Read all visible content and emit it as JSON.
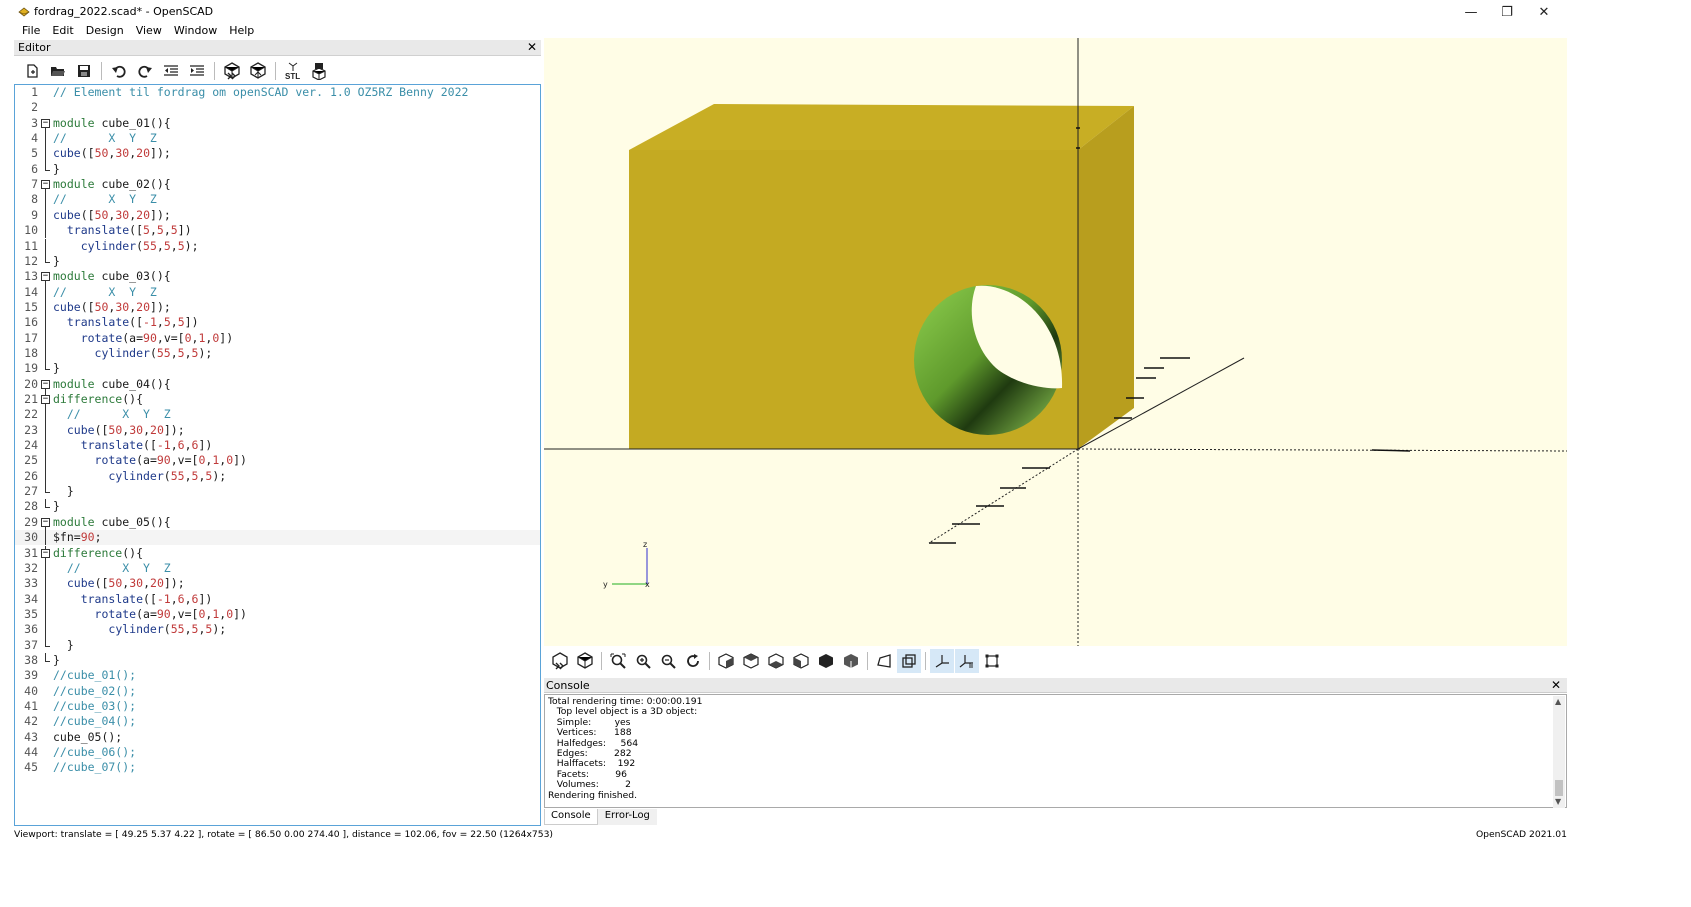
{
  "window": {
    "title": "fordrag_2022.scad* - OpenSCAD",
    "minimize_symbol": "—",
    "maximize_symbol": "❐",
    "close_symbol": "✕"
  },
  "menu": [
    "File",
    "Edit",
    "Design",
    "View",
    "Window",
    "Help"
  ],
  "editor": {
    "title": "Editor",
    "close_symbol": "✕",
    "toolbar": [
      "new-file-icon",
      "open-file-icon",
      "save-icon",
      "undo-icon",
      "redo-icon",
      "unindent-icon",
      "indent-icon",
      "preview-icon",
      "render-icon",
      "export-stl-icon",
      "send-to-print-icon"
    ],
    "stl_label": "STL",
    "current_line": 30,
    "lines": [
      {
        "n": "1",
        "parts": [
          [
            "c",
            "// Element til fordrag om openSCAD ver. 1.0 OZ5RZ Benny 2022"
          ]
        ]
      },
      {
        "n": "2",
        "parts": []
      },
      {
        "n": "3",
        "fold": "open",
        "parts": [
          [
            "k",
            "module"
          ],
          [
            "p",
            " cube_01(){"
          ]
        ]
      },
      {
        "n": "4",
        "parts": [
          [
            "c",
            "//      X  Y  Z"
          ]
        ]
      },
      {
        "n": "5",
        "parts": [
          [
            "f",
            "cube"
          ],
          [
            "p",
            "(["
          ],
          [
            "d",
            "50"
          ],
          [
            "p",
            ","
          ],
          [
            "d",
            "30"
          ],
          [
            "p",
            ","
          ],
          [
            "d",
            "20"
          ],
          [
            "p",
            "]);"
          ]
        ]
      },
      {
        "n": "6",
        "fold": "end",
        "parts": [
          [
            "p",
            "}"
          ]
        ]
      },
      {
        "n": "7",
        "fold": "open",
        "parts": [
          [
            "k",
            "module"
          ],
          [
            "p",
            " cube_02(){"
          ]
        ]
      },
      {
        "n": "8",
        "parts": [
          [
            "c",
            "//      X  Y  Z"
          ]
        ]
      },
      {
        "n": "9",
        "parts": [
          [
            "f",
            "cube"
          ],
          [
            "p",
            "(["
          ],
          [
            "d",
            "50"
          ],
          [
            "p",
            ","
          ],
          [
            "d",
            "30"
          ],
          [
            "p",
            ","
          ],
          [
            "d",
            "20"
          ],
          [
            "p",
            "]);"
          ]
        ]
      },
      {
        "n": "10",
        "parts": [
          [
            "p",
            "  "
          ],
          [
            "f",
            "translate"
          ],
          [
            "p",
            "(["
          ],
          [
            "d",
            "5"
          ],
          [
            "p",
            ","
          ],
          [
            "d",
            "5"
          ],
          [
            "p",
            ","
          ],
          [
            "d",
            "5"
          ],
          [
            "p",
            "])"
          ]
        ]
      },
      {
        "n": "11",
        "parts": [
          [
            "p",
            "    "
          ],
          [
            "f",
            "cylinder"
          ],
          [
            "p",
            "("
          ],
          [
            "d",
            "55"
          ],
          [
            "p",
            ","
          ],
          [
            "d",
            "5"
          ],
          [
            "p",
            ","
          ],
          [
            "d",
            "5"
          ],
          [
            "p",
            ");"
          ]
        ]
      },
      {
        "n": "12",
        "fold": "end",
        "parts": [
          [
            "p",
            "}"
          ]
        ]
      },
      {
        "n": "13",
        "fold": "open",
        "parts": [
          [
            "k",
            "module"
          ],
          [
            "p",
            " cube_03(){"
          ]
        ]
      },
      {
        "n": "14",
        "parts": [
          [
            "c",
            "//      X  Y  Z"
          ]
        ]
      },
      {
        "n": "15",
        "parts": [
          [
            "f",
            "cube"
          ],
          [
            "p",
            "(["
          ],
          [
            "d",
            "50"
          ],
          [
            "p",
            ","
          ],
          [
            "d",
            "30"
          ],
          [
            "p",
            ","
          ],
          [
            "d",
            "20"
          ],
          [
            "p",
            "]);"
          ]
        ]
      },
      {
        "n": "16",
        "parts": [
          [
            "p",
            "  "
          ],
          [
            "f",
            "translate"
          ],
          [
            "p",
            "(["
          ],
          [
            "d",
            "-1"
          ],
          [
            "p",
            ","
          ],
          [
            "d",
            "5"
          ],
          [
            "p",
            ","
          ],
          [
            "d",
            "5"
          ],
          [
            "p",
            "])"
          ]
        ]
      },
      {
        "n": "17",
        "parts": [
          [
            "p",
            "    "
          ],
          [
            "f",
            "rotate"
          ],
          [
            "p",
            "(a="
          ],
          [
            "d",
            "90"
          ],
          [
            "p",
            ",v=["
          ],
          [
            "d",
            "0"
          ],
          [
            "p",
            ","
          ],
          [
            "d",
            "1"
          ],
          [
            "p",
            ","
          ],
          [
            "d",
            "0"
          ],
          [
            "p",
            "])"
          ]
        ]
      },
      {
        "n": "18",
        "parts": [
          [
            "p",
            "      "
          ],
          [
            "f",
            "cylinder"
          ],
          [
            "p",
            "("
          ],
          [
            "d",
            "55"
          ],
          [
            "p",
            ","
          ],
          [
            "d",
            "5"
          ],
          [
            "p",
            ","
          ],
          [
            "d",
            "5"
          ],
          [
            "p",
            ");"
          ]
        ]
      },
      {
        "n": "19",
        "fold": "end",
        "parts": [
          [
            "p",
            "}"
          ]
        ]
      },
      {
        "n": "20",
        "fold": "open",
        "parts": [
          [
            "k",
            "module"
          ],
          [
            "p",
            " cube_04(){"
          ]
        ]
      },
      {
        "n": "21",
        "fold": "open",
        "parts": [
          [
            "k",
            "difference"
          ],
          [
            "p",
            "(){"
          ]
        ]
      },
      {
        "n": "22",
        "parts": [
          [
            "p",
            "  "
          ],
          [
            "c",
            "//      X  Y  Z"
          ]
        ]
      },
      {
        "n": "23",
        "parts": [
          [
            "p",
            "  "
          ],
          [
            "f",
            "cube"
          ],
          [
            "p",
            "(["
          ],
          [
            "d",
            "50"
          ],
          [
            "p",
            ","
          ],
          [
            "d",
            "30"
          ],
          [
            "p",
            ","
          ],
          [
            "d",
            "20"
          ],
          [
            "p",
            "]);"
          ]
        ]
      },
      {
        "n": "24",
        "parts": [
          [
            "p",
            "    "
          ],
          [
            "f",
            "translate"
          ],
          [
            "p",
            "(["
          ],
          [
            "d",
            "-1"
          ],
          [
            "p",
            ","
          ],
          [
            "d",
            "6"
          ],
          [
            "p",
            ","
          ],
          [
            "d",
            "6"
          ],
          [
            "p",
            "])"
          ]
        ]
      },
      {
        "n": "25",
        "parts": [
          [
            "p",
            "      "
          ],
          [
            "f",
            "rotate"
          ],
          [
            "p",
            "(a="
          ],
          [
            "d",
            "90"
          ],
          [
            "p",
            ",v=["
          ],
          [
            "d",
            "0"
          ],
          [
            "p",
            ","
          ],
          [
            "d",
            "1"
          ],
          [
            "p",
            ","
          ],
          [
            "d",
            "0"
          ],
          [
            "p",
            "])"
          ]
        ]
      },
      {
        "n": "26",
        "parts": [
          [
            "p",
            "        "
          ],
          [
            "f",
            "cylinder"
          ],
          [
            "p",
            "("
          ],
          [
            "d",
            "55"
          ],
          [
            "p",
            ","
          ],
          [
            "d",
            "5"
          ],
          [
            "p",
            ","
          ],
          [
            "d",
            "5"
          ],
          [
            "p",
            ");"
          ]
        ]
      },
      {
        "n": "27",
        "fold": "mid",
        "parts": [
          [
            "p",
            "  }"
          ]
        ]
      },
      {
        "n": "28",
        "fold": "end",
        "parts": [
          [
            "p",
            "}"
          ]
        ]
      },
      {
        "n": "29",
        "fold": "open",
        "parts": [
          [
            "k",
            "module"
          ],
          [
            "p",
            " cube_05(){"
          ]
        ]
      },
      {
        "n": "30",
        "parts": [
          [
            "p",
            "$fn="
          ],
          [
            "d",
            "90"
          ],
          [
            "p",
            ";"
          ]
        ]
      },
      {
        "n": "31",
        "fold": "open",
        "parts": [
          [
            "k",
            "difference"
          ],
          [
            "p",
            "(){"
          ]
        ]
      },
      {
        "n": "32",
        "parts": [
          [
            "p",
            "  "
          ],
          [
            "c",
            "//      X  Y  Z"
          ]
        ]
      },
      {
        "n": "33",
        "parts": [
          [
            "p",
            "  "
          ],
          [
            "f",
            "cube"
          ],
          [
            "p",
            "(["
          ],
          [
            "d",
            "50"
          ],
          [
            "p",
            ","
          ],
          [
            "d",
            "30"
          ],
          [
            "p",
            ","
          ],
          [
            "d",
            "20"
          ],
          [
            "p",
            "]);"
          ]
        ]
      },
      {
        "n": "34",
        "parts": [
          [
            "p",
            "    "
          ],
          [
            "f",
            "translate"
          ],
          [
            "p",
            "(["
          ],
          [
            "d",
            "-1"
          ],
          [
            "p",
            ","
          ],
          [
            "d",
            "6"
          ],
          [
            "p",
            ","
          ],
          [
            "d",
            "6"
          ],
          [
            "p",
            "])"
          ]
        ]
      },
      {
        "n": "35",
        "parts": [
          [
            "p",
            "      "
          ],
          [
            "f",
            "rotate"
          ],
          [
            "p",
            "(a="
          ],
          [
            "d",
            "90"
          ],
          [
            "p",
            ",v=["
          ],
          [
            "d",
            "0"
          ],
          [
            "p",
            ","
          ],
          [
            "d",
            "1"
          ],
          [
            "p",
            ","
          ],
          [
            "d",
            "0"
          ],
          [
            "p",
            "])"
          ]
        ]
      },
      {
        "n": "36",
        "parts": [
          [
            "p",
            "        "
          ],
          [
            "f",
            "cylinder"
          ],
          [
            "p",
            "("
          ],
          [
            "d",
            "55"
          ],
          [
            "p",
            ","
          ],
          [
            "d",
            "5"
          ],
          [
            "p",
            ","
          ],
          [
            "d",
            "5"
          ],
          [
            "p",
            ");"
          ]
        ]
      },
      {
        "n": "37",
        "fold": "mid",
        "parts": [
          [
            "p",
            "  }"
          ]
        ]
      },
      {
        "n": "38",
        "fold": "end",
        "parts": [
          [
            "p",
            "}"
          ]
        ]
      },
      {
        "n": "39",
        "parts": [
          [
            "c",
            "//cube_01();"
          ]
        ]
      },
      {
        "n": "40",
        "parts": [
          [
            "c",
            "//cube_02();"
          ]
        ]
      },
      {
        "n": "41",
        "parts": [
          [
            "c",
            "//cube_03();"
          ]
        ]
      },
      {
        "n": "42",
        "parts": [
          [
            "c",
            "//cube_04();"
          ]
        ]
      },
      {
        "n": "43",
        "parts": [
          [
            "p",
            "cube_05();"
          ]
        ]
      },
      {
        "n": "44",
        "parts": [
          [
            "c",
            "//cube_06();"
          ]
        ]
      },
      {
        "n": "45",
        "parts": [
          [
            "c",
            "//cube_07();"
          ]
        ]
      }
    ]
  },
  "viewport": {
    "axis_labels": {
      "z": "z",
      "y": "y",
      "x": "x"
    },
    "colors": {
      "background": "#fffde6",
      "model": "#c4aa22",
      "model_top": "#c8ae24",
      "model_side": "#b89e1e",
      "cutout": "#7fbf3f"
    }
  },
  "view_toolbar": [
    "preview-icon",
    "render-icon",
    "view-all-icon",
    "zoom-in-icon",
    "zoom-out-icon",
    "reset-view-icon",
    "view-right-icon",
    "view-top-icon",
    "view-bottom-icon",
    "view-left-icon",
    "view-front-icon",
    "view-back-icon",
    "perspective-icon",
    "orthogonal-icon",
    "show-axes-icon",
    "show-scale-icon",
    "show-edges-icon"
  ],
  "console": {
    "title": "Console",
    "close_symbol": "✕",
    "lines": [
      "Total rendering time: 0:00:00.191",
      "   Top level object is a 3D object:",
      "   Simple:        yes",
      "   Vertices:      188",
      "   Halfedges:     564",
      "   Edges:         282",
      "   Halffacets:    192",
      "   Facets:         96",
      "   Volumes:         2",
      "Rendering finished."
    ],
    "tabs": [
      "Console",
      "Error-Log"
    ]
  },
  "status": {
    "viewport": "Viewport: translate = [ 49.25 5.37 4.22 ], rotate = [ 86.50 0.00 274.40 ], distance = 102.06, fov = 22.50 (1264x753)",
    "version": "OpenSCAD 2021.01"
  }
}
